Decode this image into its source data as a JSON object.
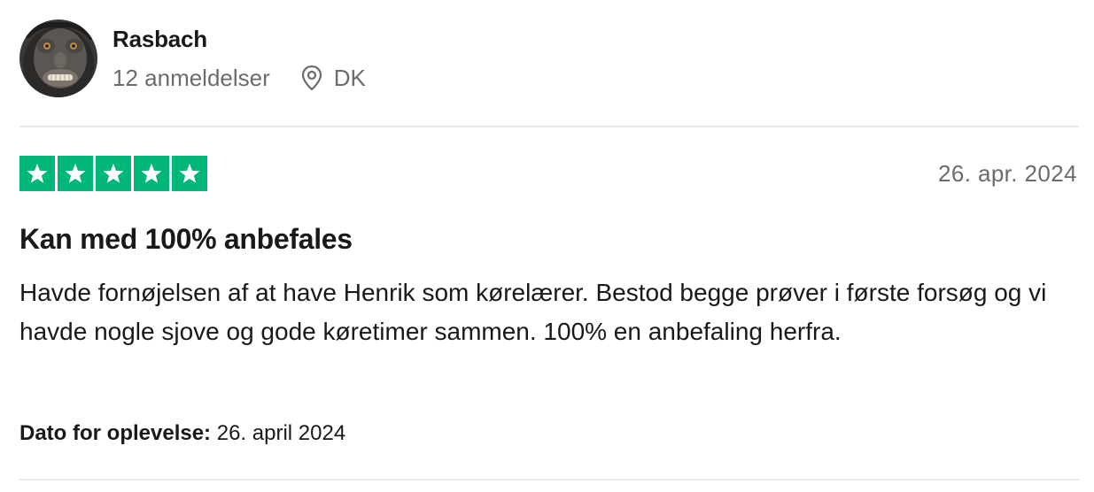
{
  "reviewer": {
    "name": "Rasbach",
    "review_count": "12 anmeldelser",
    "country": "DK",
    "avatar_icon": "monkey-avatar",
    "location_icon": "map-pin-icon"
  },
  "review": {
    "rating": 5,
    "max_rating": 5,
    "star_color": "#00b67a",
    "date": "26. apr. 2024",
    "title": "Kan med 100% anbefales",
    "body": "Havde fornøjelsen af at have Henrik som kørelærer. Bestod begge prøver i første forsøg og vi havde nogle sjove og gode køretimer sammen. 100% en anbefaling herfra.",
    "experience_label": "Dato for oplevelse:",
    "experience_date": "26. april 2024"
  }
}
